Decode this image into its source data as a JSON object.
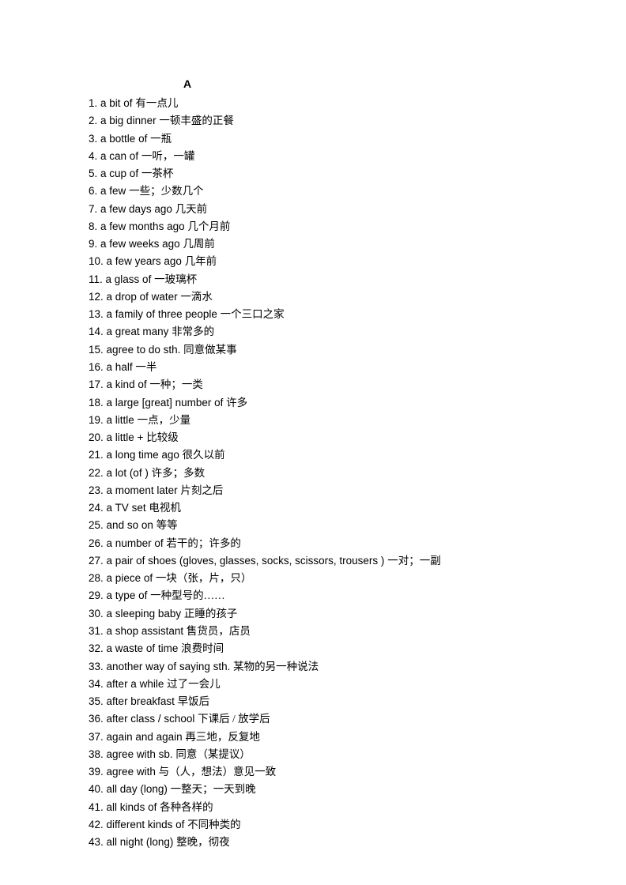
{
  "heading": "A",
  "entries": [
    {
      "num": "1.",
      "en": "a bit of",
      "zh": "有一点儿"
    },
    {
      "num": "2.",
      "en": "a big dinner",
      "zh": "一顿丰盛的正餐"
    },
    {
      "num": "3.",
      "en": "a bottle of",
      "zh": "一瓶"
    },
    {
      "num": "4.",
      "en": "a can of",
      "zh": "一听，一罐"
    },
    {
      "num": "5.",
      "en": "a cup of",
      "zh": "一茶杯"
    },
    {
      "num": "6.",
      "en": "a few",
      "zh": "一些；少数几个"
    },
    {
      "num": "7.",
      "en": "a few days ago",
      "zh": "几天前"
    },
    {
      "num": "8.",
      "en": "a few months ago",
      "zh": "几个月前"
    },
    {
      "num": "9.",
      "en": "a few weeks ago",
      "zh": "几周前"
    },
    {
      "num": "10.",
      "en": "a few years ago",
      "zh": "几年前"
    },
    {
      "num": "11.",
      "en": "a glass of",
      "zh": "一玻璃杯"
    },
    {
      "num": "12.",
      "en": "a drop of water",
      "zh": "一滴水"
    },
    {
      "num": "13.",
      "en": "a family of three people",
      "zh": "一个三口之家"
    },
    {
      "num": "14.",
      "en": "a great many",
      "zh": "非常多的"
    },
    {
      "num": "15.",
      "en": "agree to do sth.",
      "zh": "同意做某事"
    },
    {
      "num": "16.",
      "en": "a half",
      "zh": "一半"
    },
    {
      "num": "17.",
      "en": "a kind of",
      "zh": "一种；一类"
    },
    {
      "num": "18.",
      "en": "a large [great] number of",
      "zh": "许多"
    },
    {
      "num": "19.",
      "en": "a little",
      "zh": "一点，少量"
    },
    {
      "num": "20.",
      "en": "a little +",
      "zh": "比较级"
    },
    {
      "num": "21.",
      "en": "a long time ago",
      "zh": "很久以前"
    },
    {
      "num": "22.",
      "en": "a lot (of )",
      "zh": "许多；多数"
    },
    {
      "num": "23.",
      "en": "a moment later",
      "zh": "片刻之后"
    },
    {
      "num": "24.",
      "en": "a TV set",
      "zh": "电视机"
    },
    {
      "num": "25.",
      "en": "and so on",
      "zh": "等等"
    },
    {
      "num": "26.",
      "en": "a number of",
      "zh": "若干的；许多的"
    },
    {
      "num": "27.",
      "en": "a pair of shoes (gloves, glasses, socks, scissors, trousers )",
      "zh": "一对；一副"
    },
    {
      "num": "28.",
      "en": "a piece of",
      "zh": "一块（张，片，只）"
    },
    {
      "num": "29.",
      "en": "a type of",
      "zh": "一种型号的……"
    },
    {
      "num": "30.",
      "en": "a sleeping baby",
      "zh": "正睡的孩子"
    },
    {
      "num": "31.",
      "en": "a shop assistant",
      "zh": "售货员，店员"
    },
    {
      "num": "32.",
      "en": "a waste of time",
      "zh": "浪费时间"
    },
    {
      "num": "33.",
      "en": "another way of saying sth.",
      "zh": "某物的另一种说法"
    },
    {
      "num": "34.",
      "en": "after a while",
      "zh": "过了一会儿"
    },
    {
      "num": "35.",
      "en": "after breakfast",
      "zh": "早饭后"
    },
    {
      "num": "36.",
      "en": "after class / school",
      "zh": "下课后 / 放学后"
    },
    {
      "num": "37.",
      "en": "again and again",
      "zh": "再三地，反复地"
    },
    {
      "num": "38.",
      "en": "agree with sb. ",
      "zh": "同意（某提议）"
    },
    {
      "num": "39.",
      "en": "agree with",
      "zh": "与（人，想法）意见一致"
    },
    {
      "num": "40.",
      "en": "all day (long)",
      "zh": "一整天；一天到晚"
    },
    {
      "num": "41.",
      "en": "all kinds of",
      "zh": "各种各样的"
    },
    {
      "num": "42.",
      "en": "different kinds of",
      "zh": "不同种类的"
    },
    {
      "num": "43.",
      "en": "all night (long)",
      "zh": "整晚，彻夜"
    }
  ]
}
